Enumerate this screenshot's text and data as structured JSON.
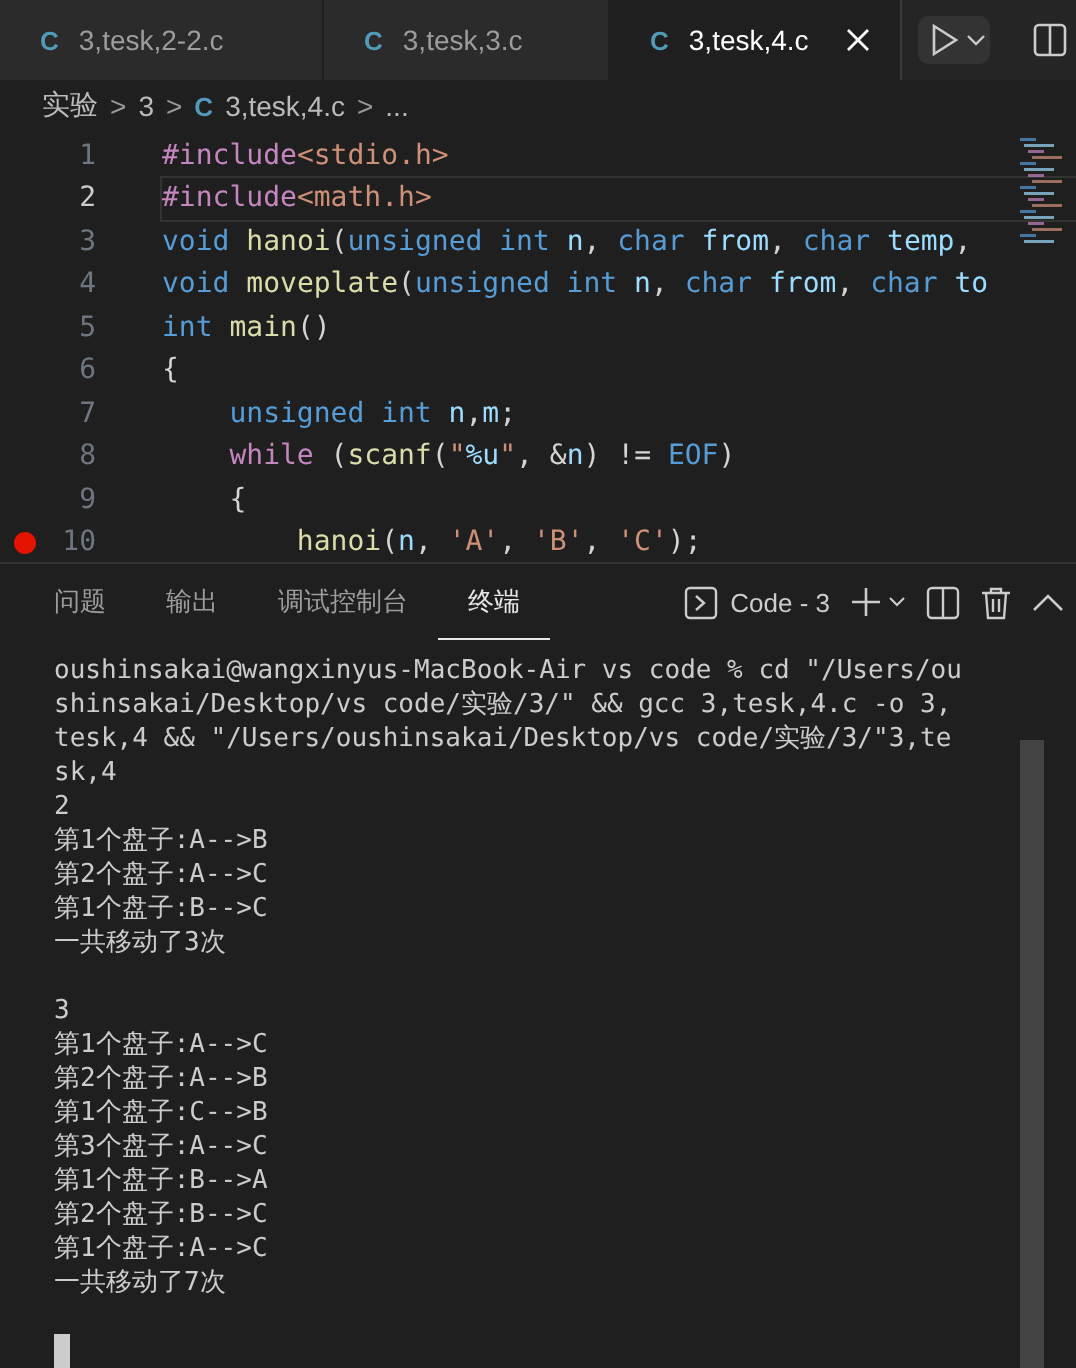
{
  "tabs": [
    {
      "label": "3,tesk,2-2.c",
      "icon": "C",
      "selected": false
    },
    {
      "label": "3,tesk,3.c",
      "icon": "C",
      "selected": false
    },
    {
      "label": "3,tesk,4.c",
      "icon": "C",
      "selected": true
    }
  ],
  "breadcrumb": {
    "items": [
      {
        "label": "实验",
        "kind": "folder"
      },
      {
        "label": "3",
        "kind": "folder"
      },
      {
        "label": "3,tesk,4.c",
        "kind": "file",
        "icon": "C"
      },
      {
        "label": "...",
        "kind": "symbol"
      }
    ],
    "separator": ">"
  },
  "editor": {
    "lines": [
      {
        "number": "1",
        "current": false,
        "breakpoint": false,
        "tokens": [
          {
            "text": "#include",
            "kind": "ctrl"
          },
          {
            "text": "<stdio.h>",
            "kind": "str"
          }
        ]
      },
      {
        "number": "2",
        "current": true,
        "breakpoint": false,
        "tokens": [
          {
            "text": "#include",
            "kind": "ctrl"
          },
          {
            "text": "<math.h>",
            "kind": "str"
          }
        ]
      },
      {
        "number": "3",
        "current": false,
        "breakpoint": false,
        "tokens": [
          {
            "text": "void ",
            "kind": "kw"
          },
          {
            "text": "hanoi",
            "kind": "fn"
          },
          {
            "text": "(",
            "kind": "plain"
          },
          {
            "text": "unsigned int ",
            "kind": "kw"
          },
          {
            "text": "n",
            "kind": "var"
          },
          {
            "text": ", ",
            "kind": "plain"
          },
          {
            "text": "char ",
            "kind": "kw"
          },
          {
            "text": "from",
            "kind": "var"
          },
          {
            "text": ", ",
            "kind": "plain"
          },
          {
            "text": "char ",
            "kind": "kw"
          },
          {
            "text": "temp",
            "kind": "var"
          },
          {
            "text": ",",
            "kind": "plain"
          }
        ]
      },
      {
        "number": "4",
        "current": false,
        "breakpoint": false,
        "tokens": [
          {
            "text": "void ",
            "kind": "kw"
          },
          {
            "text": "moveplate",
            "kind": "fn"
          },
          {
            "text": "(",
            "kind": "plain"
          },
          {
            "text": "unsigned int ",
            "kind": "kw"
          },
          {
            "text": "n",
            "kind": "var"
          },
          {
            "text": ", ",
            "kind": "plain"
          },
          {
            "text": "char ",
            "kind": "kw"
          },
          {
            "text": "from",
            "kind": "var"
          },
          {
            "text": ", ",
            "kind": "plain"
          },
          {
            "text": "char ",
            "kind": "kw"
          },
          {
            "text": "to",
            "kind": "var"
          }
        ]
      },
      {
        "number": "5",
        "current": false,
        "breakpoint": false,
        "tokens": [
          {
            "text": "int ",
            "kind": "kw"
          },
          {
            "text": "main",
            "kind": "fn"
          },
          {
            "text": "()",
            "kind": "plain"
          }
        ]
      },
      {
        "number": "6",
        "current": false,
        "breakpoint": false,
        "tokens": [
          {
            "text": "{",
            "kind": "plain"
          }
        ]
      },
      {
        "number": "7",
        "current": false,
        "breakpoint": false,
        "tokens": [
          {
            "text": "    unsigned int ",
            "kind": "kw"
          },
          {
            "text": "n",
            "kind": "var"
          },
          {
            "text": ",",
            "kind": "plain"
          },
          {
            "text": "m",
            "kind": "var"
          },
          {
            "text": ";",
            "kind": "plain"
          }
        ]
      },
      {
        "number": "8",
        "current": false,
        "breakpoint": false,
        "tokens": [
          {
            "text": "    while",
            "kind": "ctrl"
          },
          {
            "text": " (",
            "kind": "plain"
          },
          {
            "text": "scanf",
            "kind": "fn"
          },
          {
            "text": "(",
            "kind": "plain"
          },
          {
            "text": "\"",
            "kind": "str"
          },
          {
            "text": "%u",
            "kind": "var"
          },
          {
            "text": "\"",
            "kind": "str"
          },
          {
            "text": ", &",
            "kind": "plain"
          },
          {
            "text": "n",
            "kind": "var"
          },
          {
            "text": ") != ",
            "kind": "plain"
          },
          {
            "text": "EOF",
            "kind": "kw"
          },
          {
            "text": ")",
            "kind": "plain"
          }
        ]
      },
      {
        "number": "9",
        "current": false,
        "breakpoint": false,
        "tokens": [
          {
            "text": "    {",
            "kind": "plain"
          }
        ]
      },
      {
        "number": "10",
        "current": false,
        "breakpoint": true,
        "tokens": [
          {
            "text": "        hanoi",
            "kind": "fn"
          },
          {
            "text": "(",
            "kind": "plain"
          },
          {
            "text": "n",
            "kind": "var"
          },
          {
            "text": ", ",
            "kind": "plain"
          },
          {
            "text": "'A'",
            "kind": "str"
          },
          {
            "text": ", ",
            "kind": "plain"
          },
          {
            "text": "'B'",
            "kind": "str"
          },
          {
            "text": ", ",
            "kind": "plain"
          },
          {
            "text": "'C'",
            "kind": "str"
          },
          {
            "text": ");",
            "kind": "plain"
          }
        ]
      }
    ]
  },
  "panel": {
    "tabs": [
      {
        "label": "问题",
        "selected": false
      },
      {
        "label": "输出",
        "selected": false
      },
      {
        "label": "调试控制台",
        "selected": false
      },
      {
        "label": "终端",
        "selected": true
      }
    ],
    "terminal_name": "Code - 3"
  },
  "terminal": {
    "blocks": [
      {
        "lines": [
          "oushinsakai@wangxinyus-MacBook-Air vs code % cd \"/Users/ou",
          "shinsakai/Desktop/vs code/实验/3/\" && gcc 3,tesk,4.c -o 3,",
          "tesk,4 && \"/Users/oushinsakai/Desktop/vs code/实验/3/\"3,te",
          "sk,4",
          "2",
          "第1个盘子:A-->B",
          "第2个盘子:A-->C",
          "第1个盘子:B-->C",
          "一共移动了3次"
        ]
      },
      {
        "lines": [
          "3",
          "第1个盘子:A-->C",
          "第2个盘子:A-->B",
          "第1个盘子:C-->B",
          "第3个盘子:A-->C",
          "第1个盘子:B-->A",
          "第2个盘子:B-->C",
          "第1个盘子:A-->C",
          "一共移动了7次"
        ]
      }
    ],
    "cursor": true
  }
}
